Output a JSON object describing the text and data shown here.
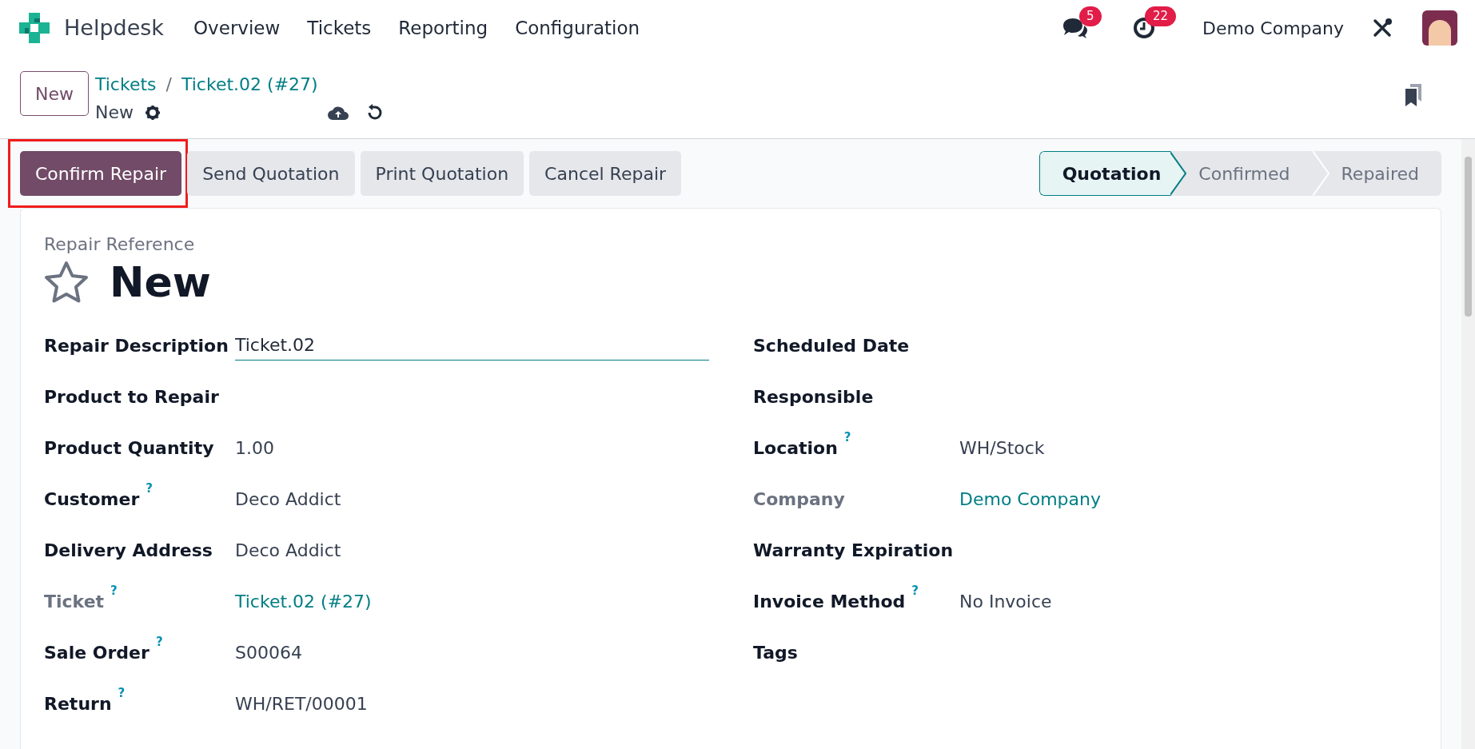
{
  "navbar": {
    "app_name": "Helpdesk",
    "menu": [
      "Overview",
      "Tickets",
      "Reporting",
      "Configuration"
    ],
    "messages_badge": "5",
    "activities_badge": "22",
    "company": "Demo Company"
  },
  "control_panel": {
    "new_button": "New",
    "breadcrumbs": [
      "Tickets",
      "Ticket.02 (#27)"
    ],
    "breadcrumb_separator": "/",
    "record_name": "New"
  },
  "actions": [
    {
      "label": "Confirm Repair",
      "kind": "primary",
      "highlighted": true
    },
    {
      "label": "Send Quotation",
      "kind": "secondary",
      "highlighted": false
    },
    {
      "label": "Print Quotation",
      "kind": "secondary",
      "highlighted": false
    },
    {
      "label": "Cancel Repair",
      "kind": "secondary",
      "highlighted": false
    }
  ],
  "stages": [
    {
      "label": "Quotation",
      "selected": true
    },
    {
      "label": "Confirmed",
      "selected": false
    },
    {
      "label": "Repaired",
      "selected": false
    }
  ],
  "form": {
    "reference_label": "Repair Reference",
    "title": "New",
    "starred": false,
    "left_fields": [
      {
        "label": "Repair Description",
        "value": "Ticket.02",
        "kind": "input",
        "muted": false
      },
      {
        "label": "Product to Repair",
        "kind": "text",
        "muted": false
      },
      {
        "label": "Product Quantity",
        "value": "1.00",
        "kind": "text",
        "muted": false
      },
      {
        "label": "Customer",
        "help": "?",
        "value": "Deco Addict",
        "kind": "text",
        "muted": false
      },
      {
        "label": "Delivery Address",
        "value": "Deco Addict",
        "kind": "text",
        "muted": false
      },
      {
        "label": "Ticket",
        "help": "?",
        "value": "Ticket.02 (#27)",
        "kind": "link",
        "muted": true
      },
      {
        "label": "Sale Order",
        "help": "?",
        "value": "S00064",
        "kind": "text",
        "muted": false
      },
      {
        "label": "Return",
        "help": "?",
        "value": "WH/RET/00001",
        "kind": "text",
        "muted": false
      }
    ],
    "right_fields": [
      {
        "label": "Scheduled Date",
        "kind": "text",
        "muted": false
      },
      {
        "label": "Responsible",
        "kind": "text",
        "muted": false
      },
      {
        "label": "Location",
        "help": "?",
        "value": "WH/Stock",
        "kind": "text",
        "muted": false
      },
      {
        "label": "Company",
        "value": "Demo Company",
        "kind": "link",
        "muted": true
      },
      {
        "label": "Warranty Expiration",
        "kind": "text",
        "muted": false
      },
      {
        "label": "Invoice Method",
        "help": "?",
        "value": "No Invoice",
        "kind": "text",
        "muted": false
      },
      {
        "label": "Tags",
        "kind": "text",
        "muted": false
      }
    ]
  }
}
